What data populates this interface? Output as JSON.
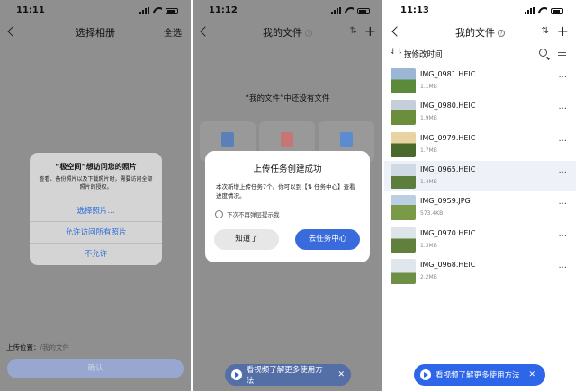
{
  "panel1": {
    "time": "11:11",
    "nav_title": "选择相册",
    "select_all": "全选",
    "dialog": {
      "title": "“极空间”想访问您的照片",
      "body": "查看、备份照片以及下载照片时，需要访问全部照片的授权。",
      "options": [
        "选择照片...",
        "允许访问所有照片",
        "不允许"
      ]
    },
    "upload_location_label": "上传位置：",
    "upload_location_path": "/我的文件",
    "confirm_label": "确认"
  },
  "panel2": {
    "time": "11:12",
    "nav_title": "我的文件",
    "empty_text": "“我的文件”中还没有文件",
    "dialog": {
      "title": "上传任务创建成功",
      "body": "本次新增上传任务7个。你可以到【⇅ 任务中心】查看进度情况。",
      "checkbox_label": "下次不再弹层提示我",
      "later_label": "知道了",
      "go_label": "去任务中心"
    },
    "video_tip": "看视频了解更多使用方法"
  },
  "panel3": {
    "time": "11:13",
    "nav_title": "我的文件",
    "sort_label": "按修改时间",
    "files": [
      {
        "name": "IMG_0981.HEIC",
        "size": "1.1MB"
      },
      {
        "name": "IMG_0980.HEIC",
        "size": "1.9MB"
      },
      {
        "name": "IMG_0979.HEIC",
        "size": "1.7MB"
      },
      {
        "name": "IMG_0965.HEIC",
        "size": "1.4MB"
      },
      {
        "name": "IMG_0959.JPG",
        "size": "573.4KB"
      },
      {
        "name": "IMG_0970.HEIC",
        "size": "1.3MB"
      },
      {
        "name": "IMG_0968.HEIC",
        "size": "2.2MB"
      }
    ],
    "selected_index": 3,
    "video_tip": "看视频了解更多使用方法"
  },
  "colors": {
    "accent": "#3a6bdc",
    "dim_overlay": "#8f8f8f",
    "ios_link": "#2c6fd8",
    "selected_row": "#eef1f8"
  }
}
